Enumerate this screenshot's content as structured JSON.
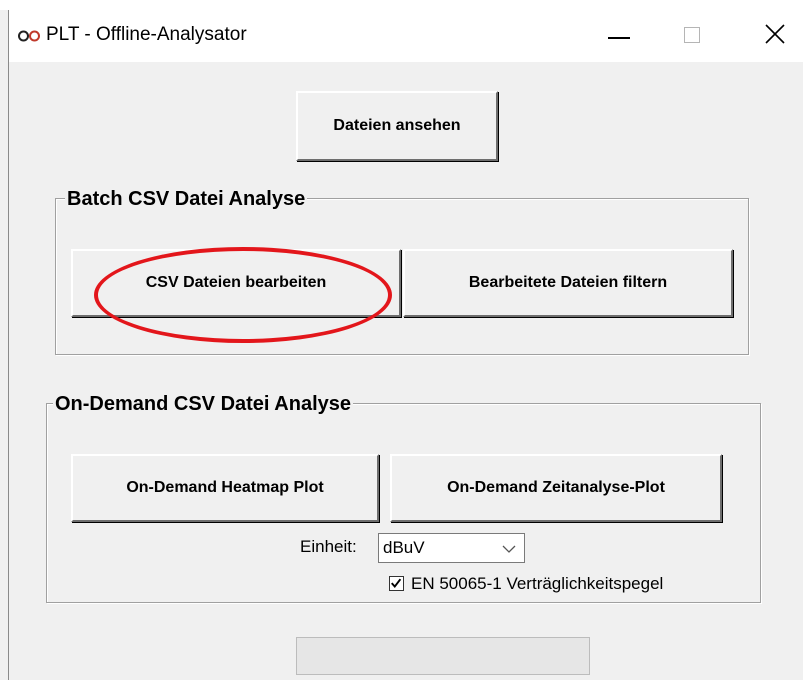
{
  "window": {
    "title": "PLT - Offline-Analysator",
    "icons": {
      "app": "infinity-logo-icon",
      "minimize": "minimize-icon",
      "maximize": "maximize-icon",
      "close": "close-icon"
    }
  },
  "main": {
    "view_files_label": "Dateien ansehen"
  },
  "batch": {
    "title": "Batch CSV Datei Analyse",
    "edit_csv_label": "CSV Dateien bearbeiten",
    "filter_label": "Bearbeitete Dateien filtern"
  },
  "on_demand": {
    "title": "On-Demand CSV Datei Analyse",
    "heatmap_label": "On-Demand Heatmap Plot",
    "time_analysis_label": "On-Demand Zeitanalyse-Plot",
    "unit_label": "Einheit:",
    "unit_value": "dBuV",
    "compat_label": "EN 50065-1 Verträglichkeitspegel",
    "compat_checked": true
  },
  "annotation_color": "#e3161b"
}
